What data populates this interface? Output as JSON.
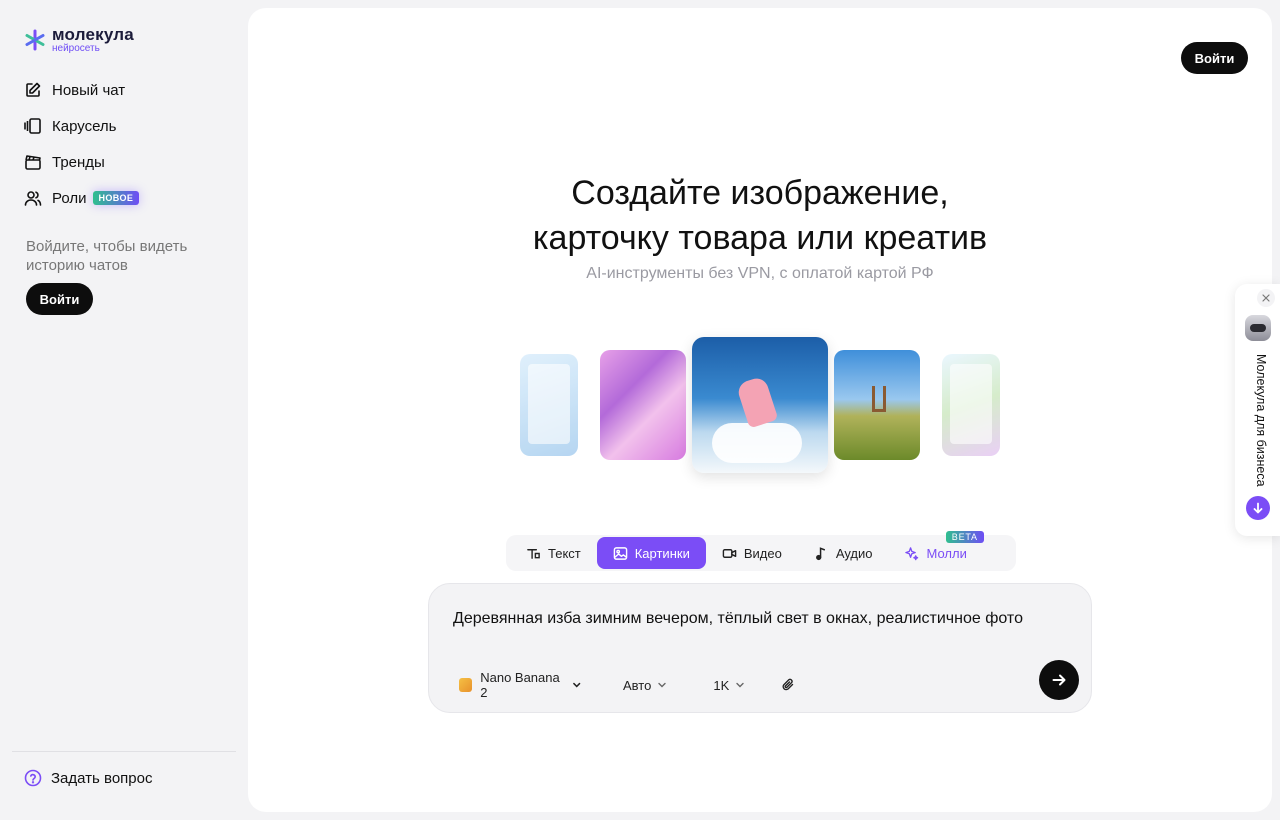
{
  "brand": {
    "name": "молекула",
    "sub": "нейросеть"
  },
  "sidebar": {
    "items": [
      {
        "label": "Новый чат",
        "icon": "edit-icon"
      },
      {
        "label": "Карусель",
        "icon": "carousel-icon"
      },
      {
        "label": "Тренды",
        "icon": "clapper-icon"
      },
      {
        "label": "Роли",
        "icon": "users-icon",
        "badge": "НОВОЕ"
      }
    ],
    "login_hint": "Войдите, чтобы видеть историю чатов",
    "login_label": "Войти",
    "help_label": "Задать вопрос"
  },
  "header": {
    "login_label": "Войти"
  },
  "hero": {
    "title_line1": "Создайте изображение,",
    "title_line2": "карточку товара или креатив",
    "subtitle": "AI-инструменты без VPN, с оплатой картой РФ"
  },
  "tabs": [
    {
      "label": "Текст",
      "icon": "text-icon"
    },
    {
      "label": "Картинки",
      "icon": "image-icon",
      "active": true
    },
    {
      "label": "Видео",
      "icon": "video-icon"
    },
    {
      "label": "Аудио",
      "icon": "music-note-icon"
    },
    {
      "label": "Молли",
      "icon": "sparkle-icon",
      "badge": "BETA"
    }
  ],
  "prompt": {
    "text": "Деревянная изба зимним вечером, тёплый свет в окнах, реалистичное фото",
    "model": "Nano Banana 2",
    "aspect": "Авто",
    "resolution": "1K"
  },
  "business_widget": {
    "label": "Молекула для бизнеса"
  },
  "colors": {
    "accent": "#7b4df6",
    "dark": "#0d0d0d",
    "background": "#f3f3f5"
  }
}
